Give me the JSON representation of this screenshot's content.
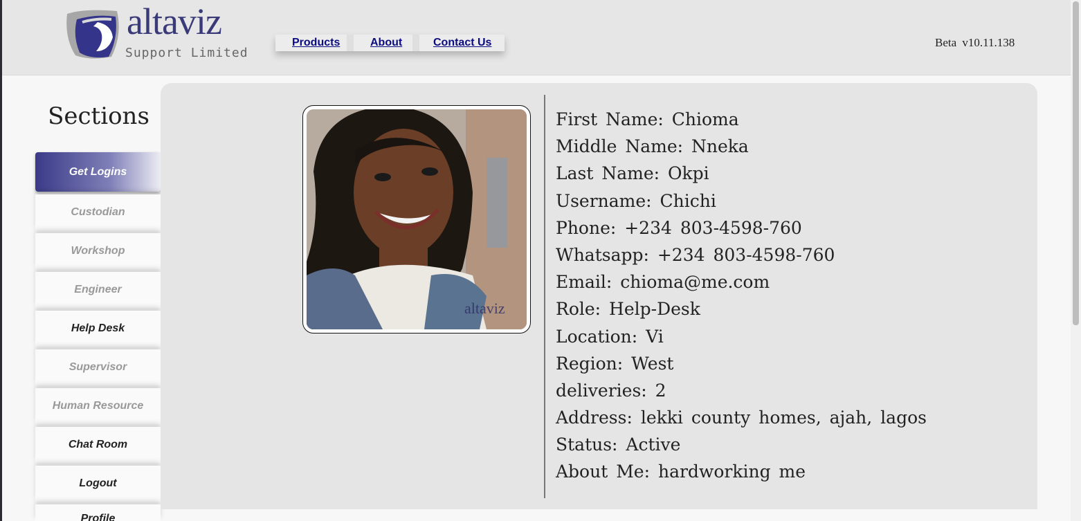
{
  "header": {
    "logo_word": "altaviz",
    "logo_sub": "Support Limited",
    "version": "Beta v10.11.138",
    "nav": [
      "Products",
      "About",
      "Contact Us"
    ]
  },
  "sidebar": {
    "title": "Sections",
    "items": [
      {
        "label": "Get Logins",
        "state": "active"
      },
      {
        "label": "Custodian",
        "state": "muted"
      },
      {
        "label": "Workshop",
        "state": "muted"
      },
      {
        "label": "Engineer",
        "state": "muted"
      },
      {
        "label": "Help Desk",
        "state": "normal"
      },
      {
        "label": "Supervisor",
        "state": "muted"
      },
      {
        "label": "Human Resource",
        "state": "muted"
      },
      {
        "label": "Chat Room",
        "state": "normal"
      },
      {
        "label": "Logout",
        "state": "normal"
      },
      {
        "label": "Profile",
        "state": "normal"
      }
    ]
  },
  "profile": {
    "photo_watermark": "altaviz",
    "fields": [
      "First Name: Chioma",
      "Middle Name: Nneka",
      "Last Name: Okpi",
      "Username: Chichi",
      "Phone: +234 803-4598-760",
      "Whatsapp: +234 803-4598-760",
      "Email: chioma@me.com",
      "Role: Help-Desk",
      "Location: Vi",
      "Region: West",
      "deliveries: 2",
      "Address: lekki county homes, ajah, lagos",
      "Status: Active",
      "About Me: hardworking me"
    ]
  },
  "colors": {
    "brand": "#3a3a78",
    "link": "#0b0b80",
    "active_button": "#3a3a88"
  }
}
